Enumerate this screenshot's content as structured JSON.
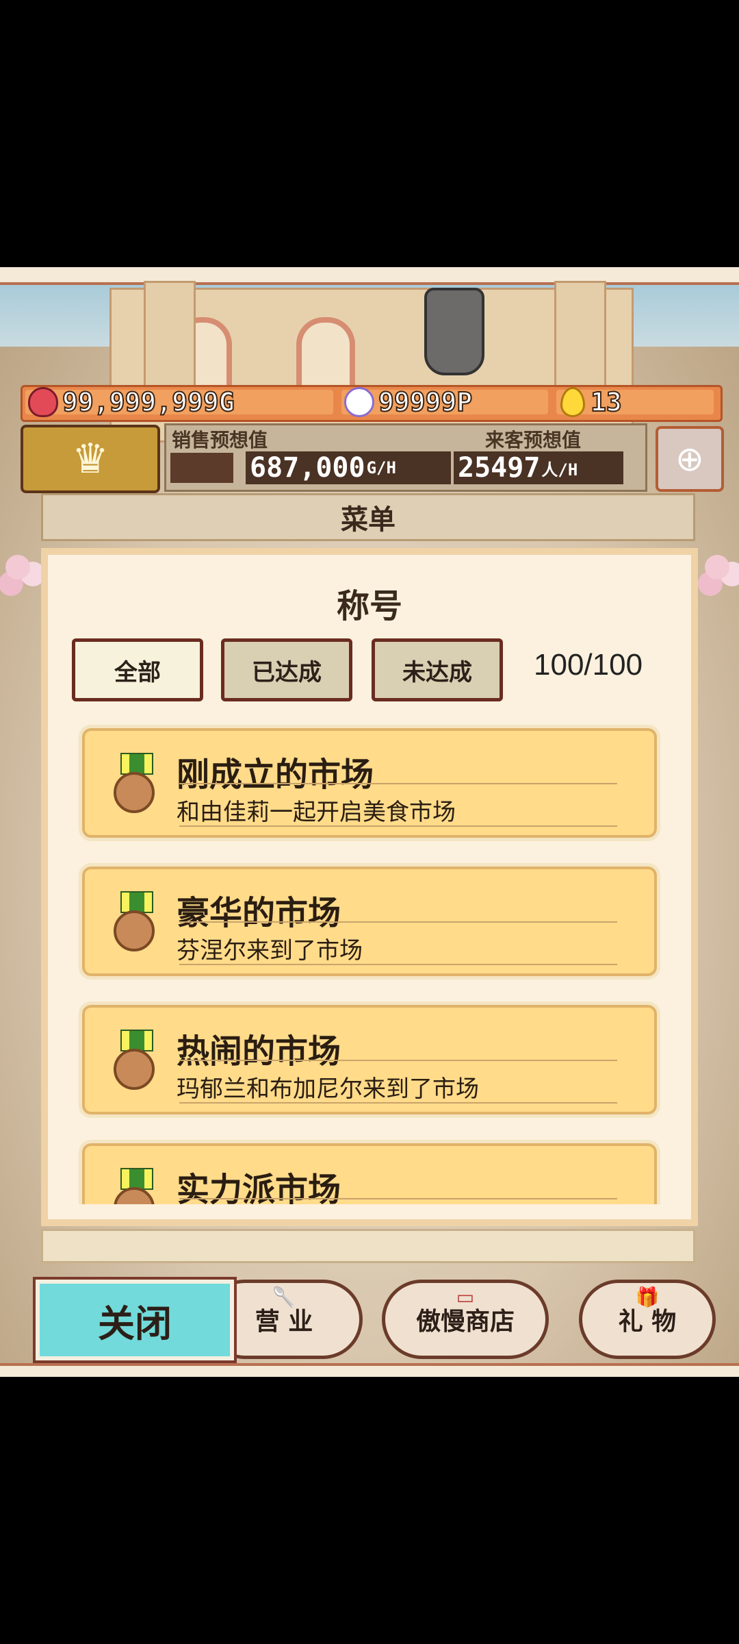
{
  "hud": {
    "gold": "99,999,999G",
    "points": "99999P",
    "eggs": "13"
  },
  "stats": {
    "sales_label": "销售预想值",
    "sales_value": "687,000",
    "sales_unit": "G/H",
    "visitors_label": "来客预想值",
    "visitors_value": "25497",
    "visitors_unit": "人/H"
  },
  "menu": {
    "header": "菜单",
    "title": "称号",
    "tabs": [
      {
        "label": "全部"
      },
      {
        "label": "已达成"
      },
      {
        "label": "未达成"
      }
    ],
    "count": "100/100",
    "items": [
      {
        "title": "刚成立的市场",
        "desc": "和由佳莉一起开启美食市场"
      },
      {
        "title": "豪华的市场",
        "desc": "芬涅尔来到了市场"
      },
      {
        "title": "热闹的市场",
        "desc": "玛郁兰和布加尼尔来到了市场"
      },
      {
        "title": "实力派市场",
        "desc": ""
      }
    ]
  },
  "bottom": {
    "close": "关闭",
    "business": "营 业",
    "shop": "傲慢商店",
    "gift": "礼 物"
  },
  "colors": {
    "close_button": "#72dada",
    "card_bg": "#ffdb8a",
    "hud_orange": "#e9874b"
  }
}
